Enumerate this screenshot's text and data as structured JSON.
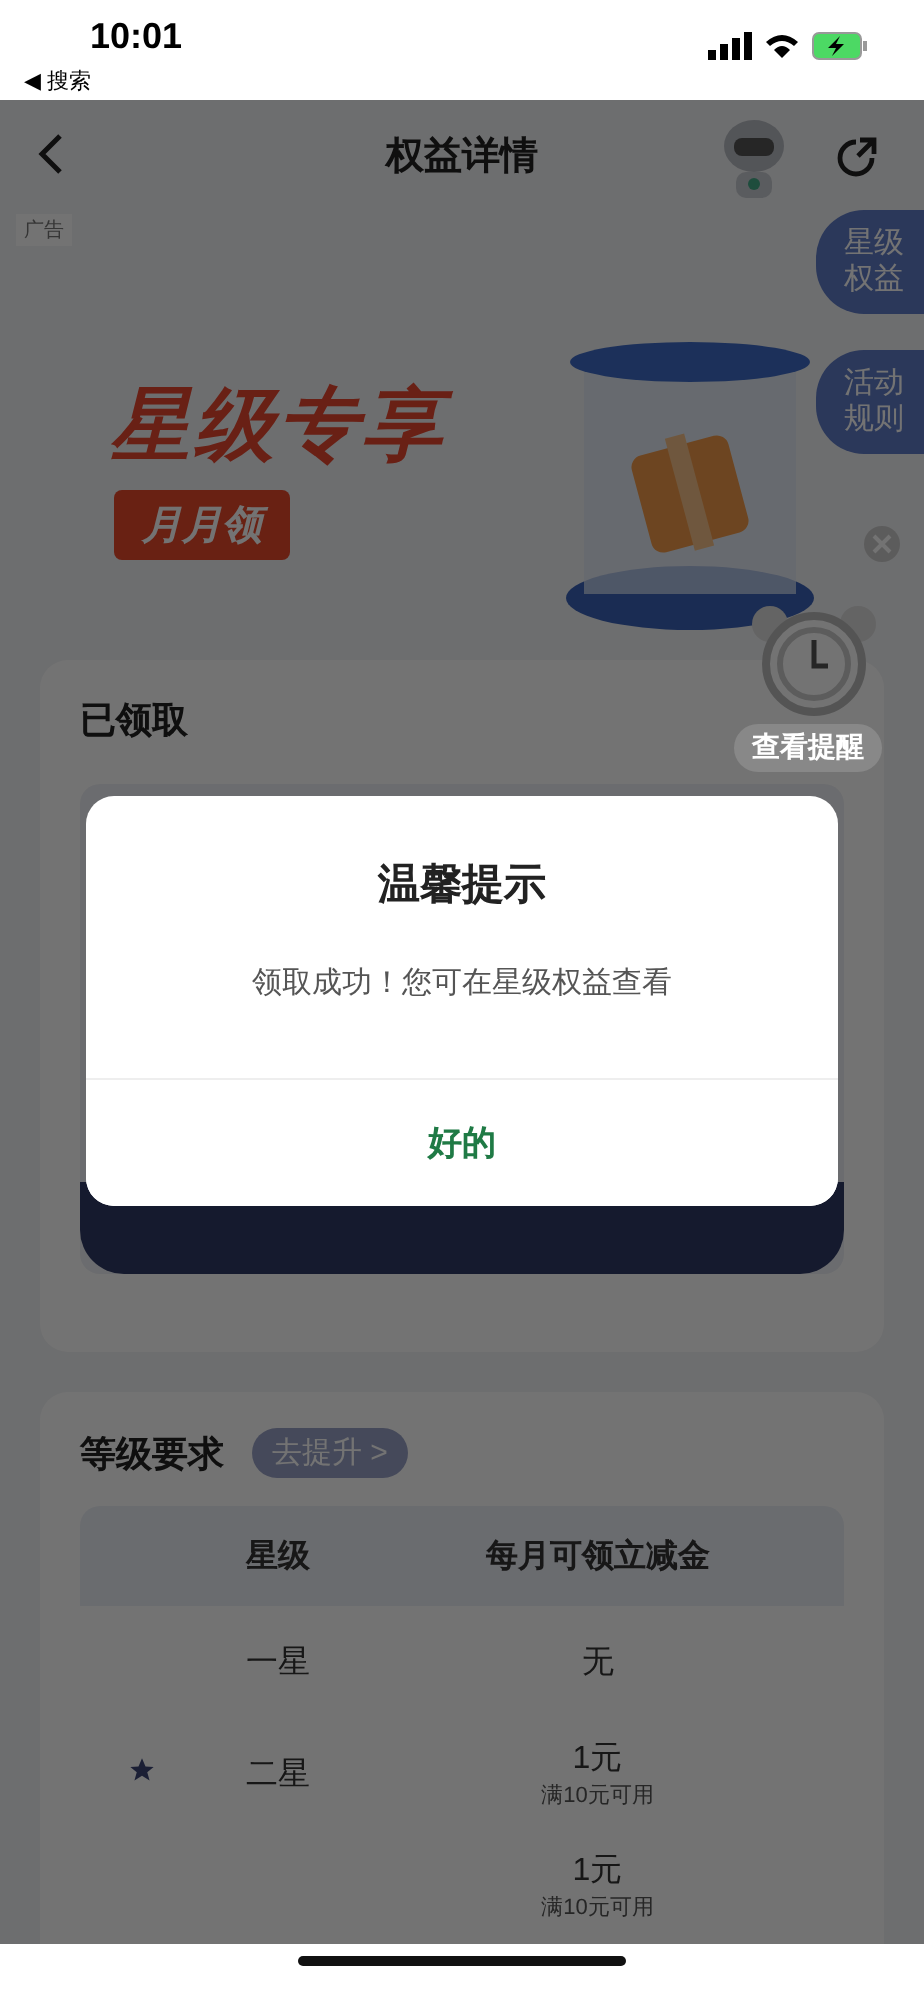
{
  "status_bar": {
    "time": "10:01",
    "back_link": "◀ 搜索"
  },
  "nav": {
    "title": "权益详情"
  },
  "ad_label": "广告",
  "side_tabs": [
    {
      "label": "星级权益"
    },
    {
      "label": "活动规则"
    }
  ],
  "banner": {
    "headline": "星级专享",
    "tag": "月月领"
  },
  "reminder": {
    "label": "查看提醒"
  },
  "claimed_card": {
    "title": "已领取"
  },
  "dialog": {
    "title": "温馨提示",
    "message": "领取成功！您可在星级权益查看",
    "button": "好的"
  },
  "level_card": {
    "title": "等级要求",
    "upgrade_button": "去提升 >",
    "table": {
      "columns": [
        "星级",
        "每月可领立减金"
      ],
      "rows": [
        {
          "level": "一星",
          "amount": "无",
          "current": false
        },
        {
          "level": "二星",
          "amount": "1元",
          "condition": "满10元可用",
          "current": true
        },
        {
          "amount": "1元",
          "condition": "满10元可用",
          "current": false
        }
      ]
    }
  }
}
